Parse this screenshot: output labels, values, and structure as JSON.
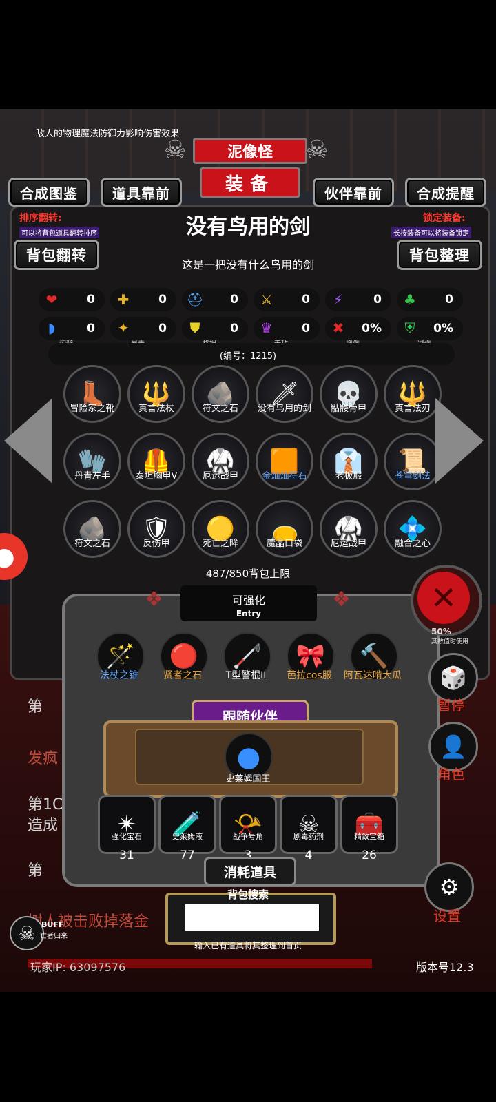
{
  "header": {
    "tip": "敌人的物理魔法防御力影响伤害效果",
    "monster": "泥像怪",
    "tab_title": "装备"
  },
  "nav_buttons": {
    "craft_guide": "合成图鉴",
    "items_front": "道具靠前",
    "partner_front": "伙伴靠前",
    "craft_remind": "合成提醒"
  },
  "sort": {
    "label": "排序翻转:",
    "hint": "可以将背包道具翻转排序",
    "button": "背包翻转"
  },
  "lock": {
    "label": "锁定装备:",
    "hint": "长按装备可以将装备锁定",
    "button": "背包整理"
  },
  "item": {
    "name": "没有鸟用的剑",
    "desc": "这是一把没有什么鸟用的剑",
    "code": "(编号：1215)"
  },
  "stats_row1": [
    {
      "icon": "heart-icon",
      "value": "0"
    },
    {
      "icon": "armor-icon",
      "value": "0"
    },
    {
      "icon": "helmet-icon",
      "value": "0"
    },
    {
      "icon": "staff-icon",
      "value": "0"
    },
    {
      "icon": "lightning-icon",
      "value": "0"
    },
    {
      "icon": "clover-icon",
      "value": "0"
    }
  ],
  "stats_row2": [
    {
      "icon": "dodge-icon",
      "label": "闪避",
      "value": "0"
    },
    {
      "icon": "crit-icon",
      "label": "暴击",
      "value": "0"
    },
    {
      "icon": "block-icon",
      "label": "格挡",
      "value": "0"
    },
    {
      "icon": "invincible-icon",
      "label": "无敌",
      "value": "0"
    },
    {
      "icon": "damage-up-icon",
      "label": "增伤",
      "value": "0%"
    },
    {
      "icon": "damage-down-icon",
      "label": "减伤",
      "value": "0%"
    }
  ],
  "inventory": [
    {
      "name": "冒险家之靴",
      "glyph": "👢"
    },
    {
      "name": "真言法杖",
      "glyph": "🔱"
    },
    {
      "name": "符文之石",
      "glyph": "🪨"
    },
    {
      "name": "没有鸟用的剑",
      "glyph": "🗡"
    },
    {
      "name": "骷髅骨甲",
      "glyph": "💀"
    },
    {
      "name": "真言法刃",
      "glyph": "🔱"
    },
    {
      "name": "丹青左手",
      "glyph": "🧤"
    },
    {
      "name": "泰坦胸甲V",
      "glyph": "🦺"
    },
    {
      "name": "厄运战甲",
      "glyph": "🥋"
    },
    {
      "name": "金灿灿符石",
      "glyph": "🟧",
      "highlight": true
    },
    {
      "name": "老板服",
      "glyph": "👔"
    },
    {
      "name": "苍穹剑法",
      "glyph": "📜",
      "highlight": true
    },
    {
      "name": "符文之石",
      "glyph": "🪨"
    },
    {
      "name": "反伤甲",
      "glyph": "🛡"
    },
    {
      "name": "死亡之眸",
      "glyph": "🟡"
    },
    {
      "name": "魔晶口袋",
      "glyph": "👝"
    },
    {
      "name": "厄运战甲",
      "glyph": "🥋"
    },
    {
      "name": "融合之心",
      "glyph": "💠"
    }
  ],
  "bag_limit": "487/850背包上限",
  "entry": {
    "title": "可强化",
    "subtitle": "Entry",
    "items": [
      {
        "name": "法杖之锥",
        "glyph": "🪄",
        "color": "#66aaff"
      },
      {
        "name": "贤者之石",
        "glyph": "🔴",
        "color": "#e9a23b"
      },
      {
        "name": "T型警棍II",
        "glyph": "🦯",
        "color": "#ffffff"
      },
      {
        "name": "芭拉cos服",
        "glyph": "🎀",
        "color": "#e9a23b"
      },
      {
        "name": "阿瓦达啃大瓜",
        "glyph": "🔨",
        "color": "#e9a23b"
      }
    ]
  },
  "partner": {
    "header": "跟随伙伴",
    "name": "史莱姆国王"
  },
  "consumables": {
    "header": "消耗道具",
    "items": [
      {
        "name": "强化宝石",
        "glyph": "✴",
        "count": "31"
      },
      {
        "name": "史莱姆液",
        "glyph": "🧪",
        "count": "77"
      },
      {
        "name": "战争号角",
        "glyph": "📯",
        "count": "3"
      },
      {
        "name": "剧毒药剂",
        "glyph": "☠",
        "count": "4"
      },
      {
        "name": "精致宝箱",
        "glyph": "🧰",
        "count": "26"
      }
    ]
  },
  "search": {
    "header": "背包搜索",
    "value": "",
    "hint": "输入已有道具将其整理到首页"
  },
  "side": {
    "pause": "暂停",
    "role": "角色",
    "settings": "设置",
    "partial_pct": "50%",
    "partial_hint": "其数值时使用"
  },
  "bottom": {
    "ip": "玩家IP:  63097576",
    "version": "版本号12.3",
    "buff": "BUFF",
    "buff_sub": "亡者归来"
  },
  "background_log": {
    "l1": "第",
    "l2": "发疯",
    "l3": "第1C",
    "l4": "造成",
    "l5": "第",
    "l6": "树人被击败掉落金"
  },
  "colors": {
    "accent_red": "#c9121a",
    "blue_label": "#66aaff",
    "gold_label": "#e9a23b"
  }
}
